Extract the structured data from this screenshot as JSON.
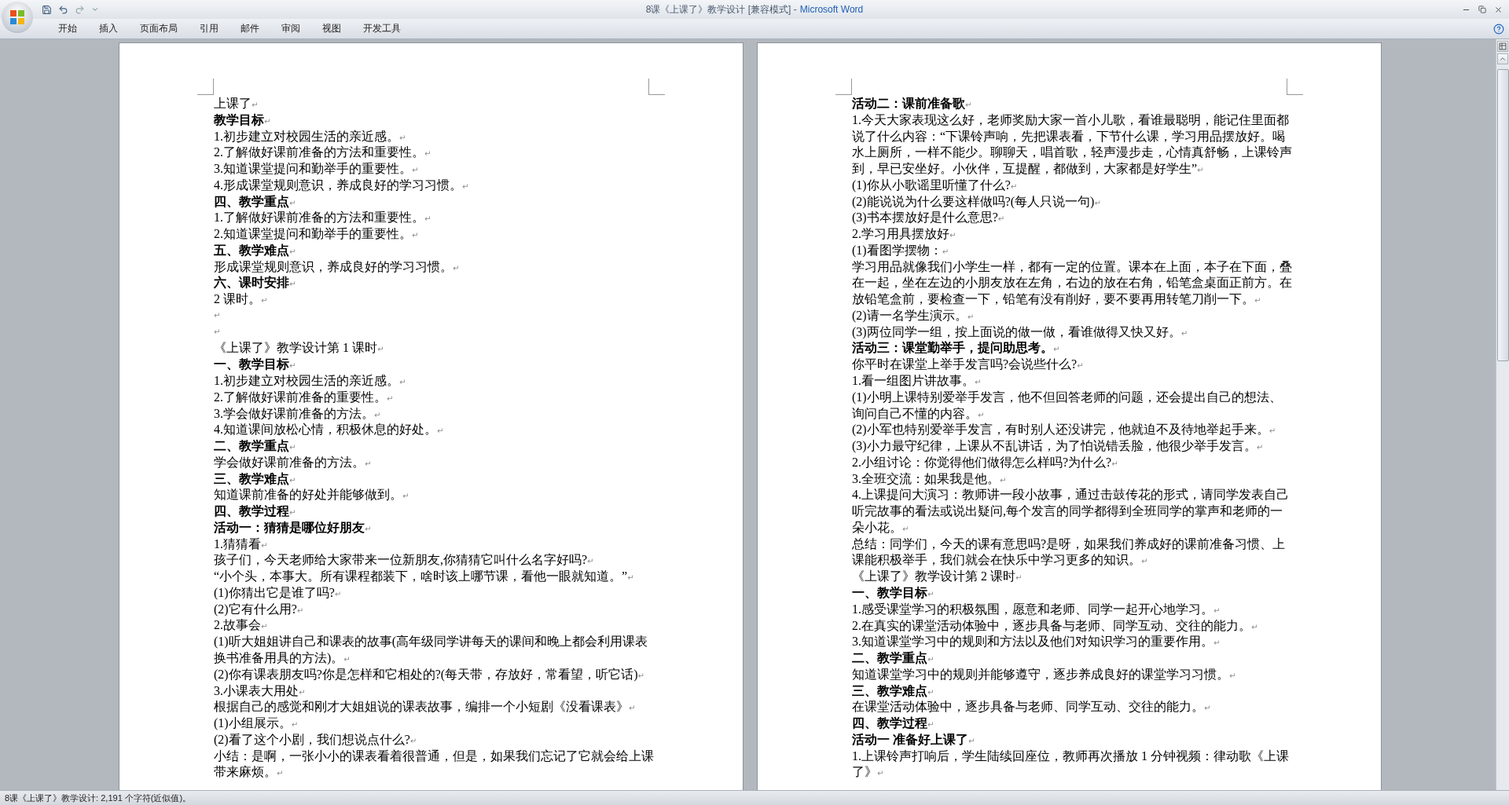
{
  "window": {
    "document": "8课《上课了》教学设计 [兼容模式] -",
    "application": "Microsoft Word"
  },
  "ribbon_tabs": [
    "开始",
    "插入",
    "页面布局",
    "引用",
    "邮件",
    "审阅",
    "视图",
    "开发工具"
  ],
  "paragraph_mark": "↵",
  "pages": [
    {
      "paragraphs": [
        {
          "kind": "text",
          "text": "上课了"
        },
        {
          "kind": "heading",
          "text": "教学目标"
        },
        {
          "kind": "text",
          "text": "1.初步建立对校园生活的亲近感。"
        },
        {
          "kind": "text",
          "text": "2.了解做好课前准备的方法和重要性。"
        },
        {
          "kind": "text",
          "text": "3.知道课堂提问和勤举手的重要性。"
        },
        {
          "kind": "text",
          "text": "4.形成课堂规则意识，养成良好的学习习惯。"
        },
        {
          "kind": "heading",
          "text": "四、教学重点"
        },
        {
          "kind": "text",
          "text": "1.了解做好课前准备的方法和重要性。"
        },
        {
          "kind": "text",
          "text": "2.知道课堂提问和勤举手的重要性。"
        },
        {
          "kind": "heading",
          "text": "五、教学难点"
        },
        {
          "kind": "text",
          "text": "形成课堂规则意识，养成良好的学习习惯。"
        },
        {
          "kind": "heading",
          "text": "六、课时安排"
        },
        {
          "kind": "text",
          "text": "2 课时。"
        },
        {
          "kind": "blank"
        },
        {
          "kind": "blank"
        },
        {
          "kind": "text",
          "text": "《上课了》教学设计第 1 课时"
        },
        {
          "kind": "heading",
          "text": "一、教学目标"
        },
        {
          "kind": "text",
          "text": "1.初步建立对校园生活的亲近感。"
        },
        {
          "kind": "text",
          "text": "2.了解做好课前准备的重要性。"
        },
        {
          "kind": "text",
          "text": "3.学会做好课前准备的方法。"
        },
        {
          "kind": "text",
          "text": "4.知道课间放松心情，积极休息的好处。"
        },
        {
          "kind": "heading",
          "text": "二、教学重点"
        },
        {
          "kind": "text",
          "text": "学会做好课前准备的方法。"
        },
        {
          "kind": "heading",
          "text": "三、教学难点"
        },
        {
          "kind": "text",
          "text": "知道课前准备的好处并能够做到。"
        },
        {
          "kind": "heading",
          "text": "四、教学过程"
        },
        {
          "kind": "heading",
          "text": "活动一：猜猜是哪位好朋友"
        },
        {
          "kind": "text",
          "text": "1.猜猜看"
        },
        {
          "kind": "text",
          "text": "孩子们，今天老师给大家带来一位新朋友,你猜猜它叫什么名字好吗?"
        },
        {
          "kind": "text",
          "text": "“小个头，本事大。所有课程都装下，啥时该上哪节课，看他一眼就知道。”"
        },
        {
          "kind": "text",
          "text": "(1)你猜出它是谁了吗?"
        },
        {
          "kind": "text",
          "text": "(2)它有什么用?"
        },
        {
          "kind": "text",
          "text": "2.故事会"
        },
        {
          "kind": "text",
          "text": "(1)听大姐姐讲自己和课表的故事(高年级同学讲每天的课间和晚上都会利用课表换书准备用具的方法)。"
        },
        {
          "kind": "text",
          "text": "(2)你有课表朋友吗?你是怎样和它相处的?(每天带，存放好，常看望，听它话)"
        },
        {
          "kind": "text",
          "text": "3.小课表大用处"
        },
        {
          "kind": "text",
          "text": "根据自己的感觉和刚才大姐姐说的课表故事，编排一个小短剧《没看课表》"
        },
        {
          "kind": "text",
          "text": "(1)小组展示。"
        },
        {
          "kind": "text",
          "text": "(2)看了这个小剧，我们想说点什么?"
        },
        {
          "kind": "text",
          "text": "小结：是啊，一张小小的课表看着很普通，但是，如果我们忘记了它就会给上课带来麻烦。"
        }
      ]
    },
    {
      "paragraphs": [
        {
          "kind": "heading",
          "text": "活动二：课前准备歌"
        },
        {
          "kind": "text",
          "text": "1.今天大家表现这么好，老师奖励大家一首小儿歌，看谁最聪明，能记住里面都说了什么内容：“下课铃声响，先把课表看，下节什么课，学习用品摆放好。喝水上厕所，一样不能少。聊聊天，唱首歌，轻声漫步走，心情真舒畅，上课铃声到，早已安坐好。小伙伴，互提醒，都做到，大家都是好学生”"
        },
        {
          "kind": "text",
          "text": "(1)你从小歌谣里听懂了什么?"
        },
        {
          "kind": "text",
          "text": "(2)能说说为什么要这样做吗?(每人只说一句)"
        },
        {
          "kind": "text",
          "text": "(3)书本摆放好是什么意思?"
        },
        {
          "kind": "text",
          "text": "2.学习用具摆放好"
        },
        {
          "kind": "text",
          "text": "(1)看图学摆物："
        },
        {
          "kind": "text",
          "text": "学习用品就像我们小学生一样，都有一定的位置。课本在上面，本子在下面，叠在一起，坐在左边的小朋友放在左角，右边的放在右角，铅笔盒桌面正前方。在放铅笔盒前，要检查一下，铅笔有没有削好，要不要再用转笔刀削一下。"
        },
        {
          "kind": "text",
          "text": "(2)请一名学生演示。"
        },
        {
          "kind": "text",
          "text": "(3)两位同学一组，按上面说的做一做，看谁做得又快又好。"
        },
        {
          "kind": "heading",
          "text": "活动三：课堂勤举手，提问助思考。"
        },
        {
          "kind": "text",
          "text": "你平时在课堂上举手发言吗?会说些什么?"
        },
        {
          "kind": "text",
          "text": "1.看一组图片讲故事。"
        },
        {
          "kind": "text",
          "text": "(1)小明上课特别爱举手发言，他不但回答老师的问题，还会提出自己的想法、询问自己不懂的内容。"
        },
        {
          "kind": "text",
          "text": "(2)小军也特别爱举手发言，有时别人还没讲完，他就迫不及待地举起手来。"
        },
        {
          "kind": "text",
          "text": "(3)小力最守纪律，上课从不乱讲话，为了怕说错丢脸，他很少举手发言。"
        },
        {
          "kind": "text",
          "text": "2.小组讨论：你觉得他们做得怎么样吗?为什么?"
        },
        {
          "kind": "text",
          "text": "3.全班交流：如果我是他。"
        },
        {
          "kind": "text",
          "text": "4.上课提问大演习：教师讲一段小故事，通过击鼓传花的形式，请同学发表自己听完故事的看法或说出疑问,每个发言的同学都得到全班同学的掌声和老师的一朵小花。"
        },
        {
          "kind": "text",
          "text": "总结：同学们，今天的课有意思吗?是呀，如果我们养成好的课前准备习惯、上课能积极举手，我们就会在快乐中学习更多的知识。"
        },
        {
          "kind": "text",
          "text": "《上课了》教学设计第 2 课时"
        },
        {
          "kind": "heading",
          "text": "一、教学目标"
        },
        {
          "kind": "text",
          "text": "1.感受课堂学习的积极氛围，愿意和老师、同学一起开心地学习。"
        },
        {
          "kind": "text",
          "text": "2.在真实的课堂活动体验中，逐步具备与老师、同学互动、交往的能力。"
        },
        {
          "kind": "text",
          "text": "3.知道课堂学习中的规则和方法以及他们对知识学习的重要作用。"
        },
        {
          "kind": "heading",
          "text": "二、教学重点"
        },
        {
          "kind": "text",
          "text": "知道课堂学习中的规则并能够遵守，逐步养成良好的课堂学习习惯。"
        },
        {
          "kind": "heading",
          "text": "三、教学难点"
        },
        {
          "kind": "text",
          "text": "在课堂活动体验中，逐步具备与老师、同学互动、交往的能力。"
        },
        {
          "kind": "heading",
          "text": "四、教学过程"
        },
        {
          "kind": "heading",
          "text": "活动一  准备好上课了"
        },
        {
          "kind": "text",
          "text": "1.上课铃声打响后，学生陆续回座位，教师再次播放 1 分钟视频：律动歌《上课了》"
        }
      ]
    }
  ],
  "status_bar": {
    "text": "8课《上课了》教学设计: 2,191 个字符(近似值)。"
  }
}
